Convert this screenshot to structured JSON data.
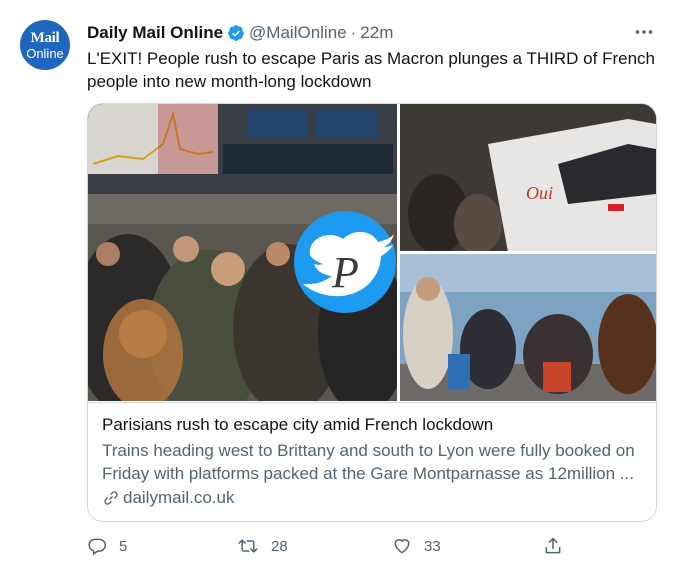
{
  "tweet": {
    "author": {
      "display_name": "Daily Mail Online",
      "handle": "@MailOnline",
      "separator": "·",
      "time": "22m",
      "avatar_line1": "Mail",
      "avatar_line2": "Online"
    },
    "text": "L'EXIT! People rush to escape Paris as Macron plunges a THIRD of French people into new month-long lockdown",
    "card": {
      "title": "Parisians rush to escape city amid French lockdown",
      "description": "Trains heading west to Brittany and south to Lyon were fully booked on Friday with platforms packed at the Gare Montparnasse as 12million ...",
      "domain": "dailymail.co.uk",
      "media_icons": [
        "twitter-bird-icon",
        "script-letter-icon"
      ]
    },
    "actions": {
      "replies": "5",
      "retweets": "28",
      "likes": "33"
    }
  },
  "colors": {
    "brand": "#1d67bd",
    "verified": "#1d9bf0",
    "secondary_text": "#536471",
    "border": "#cfd9de"
  }
}
